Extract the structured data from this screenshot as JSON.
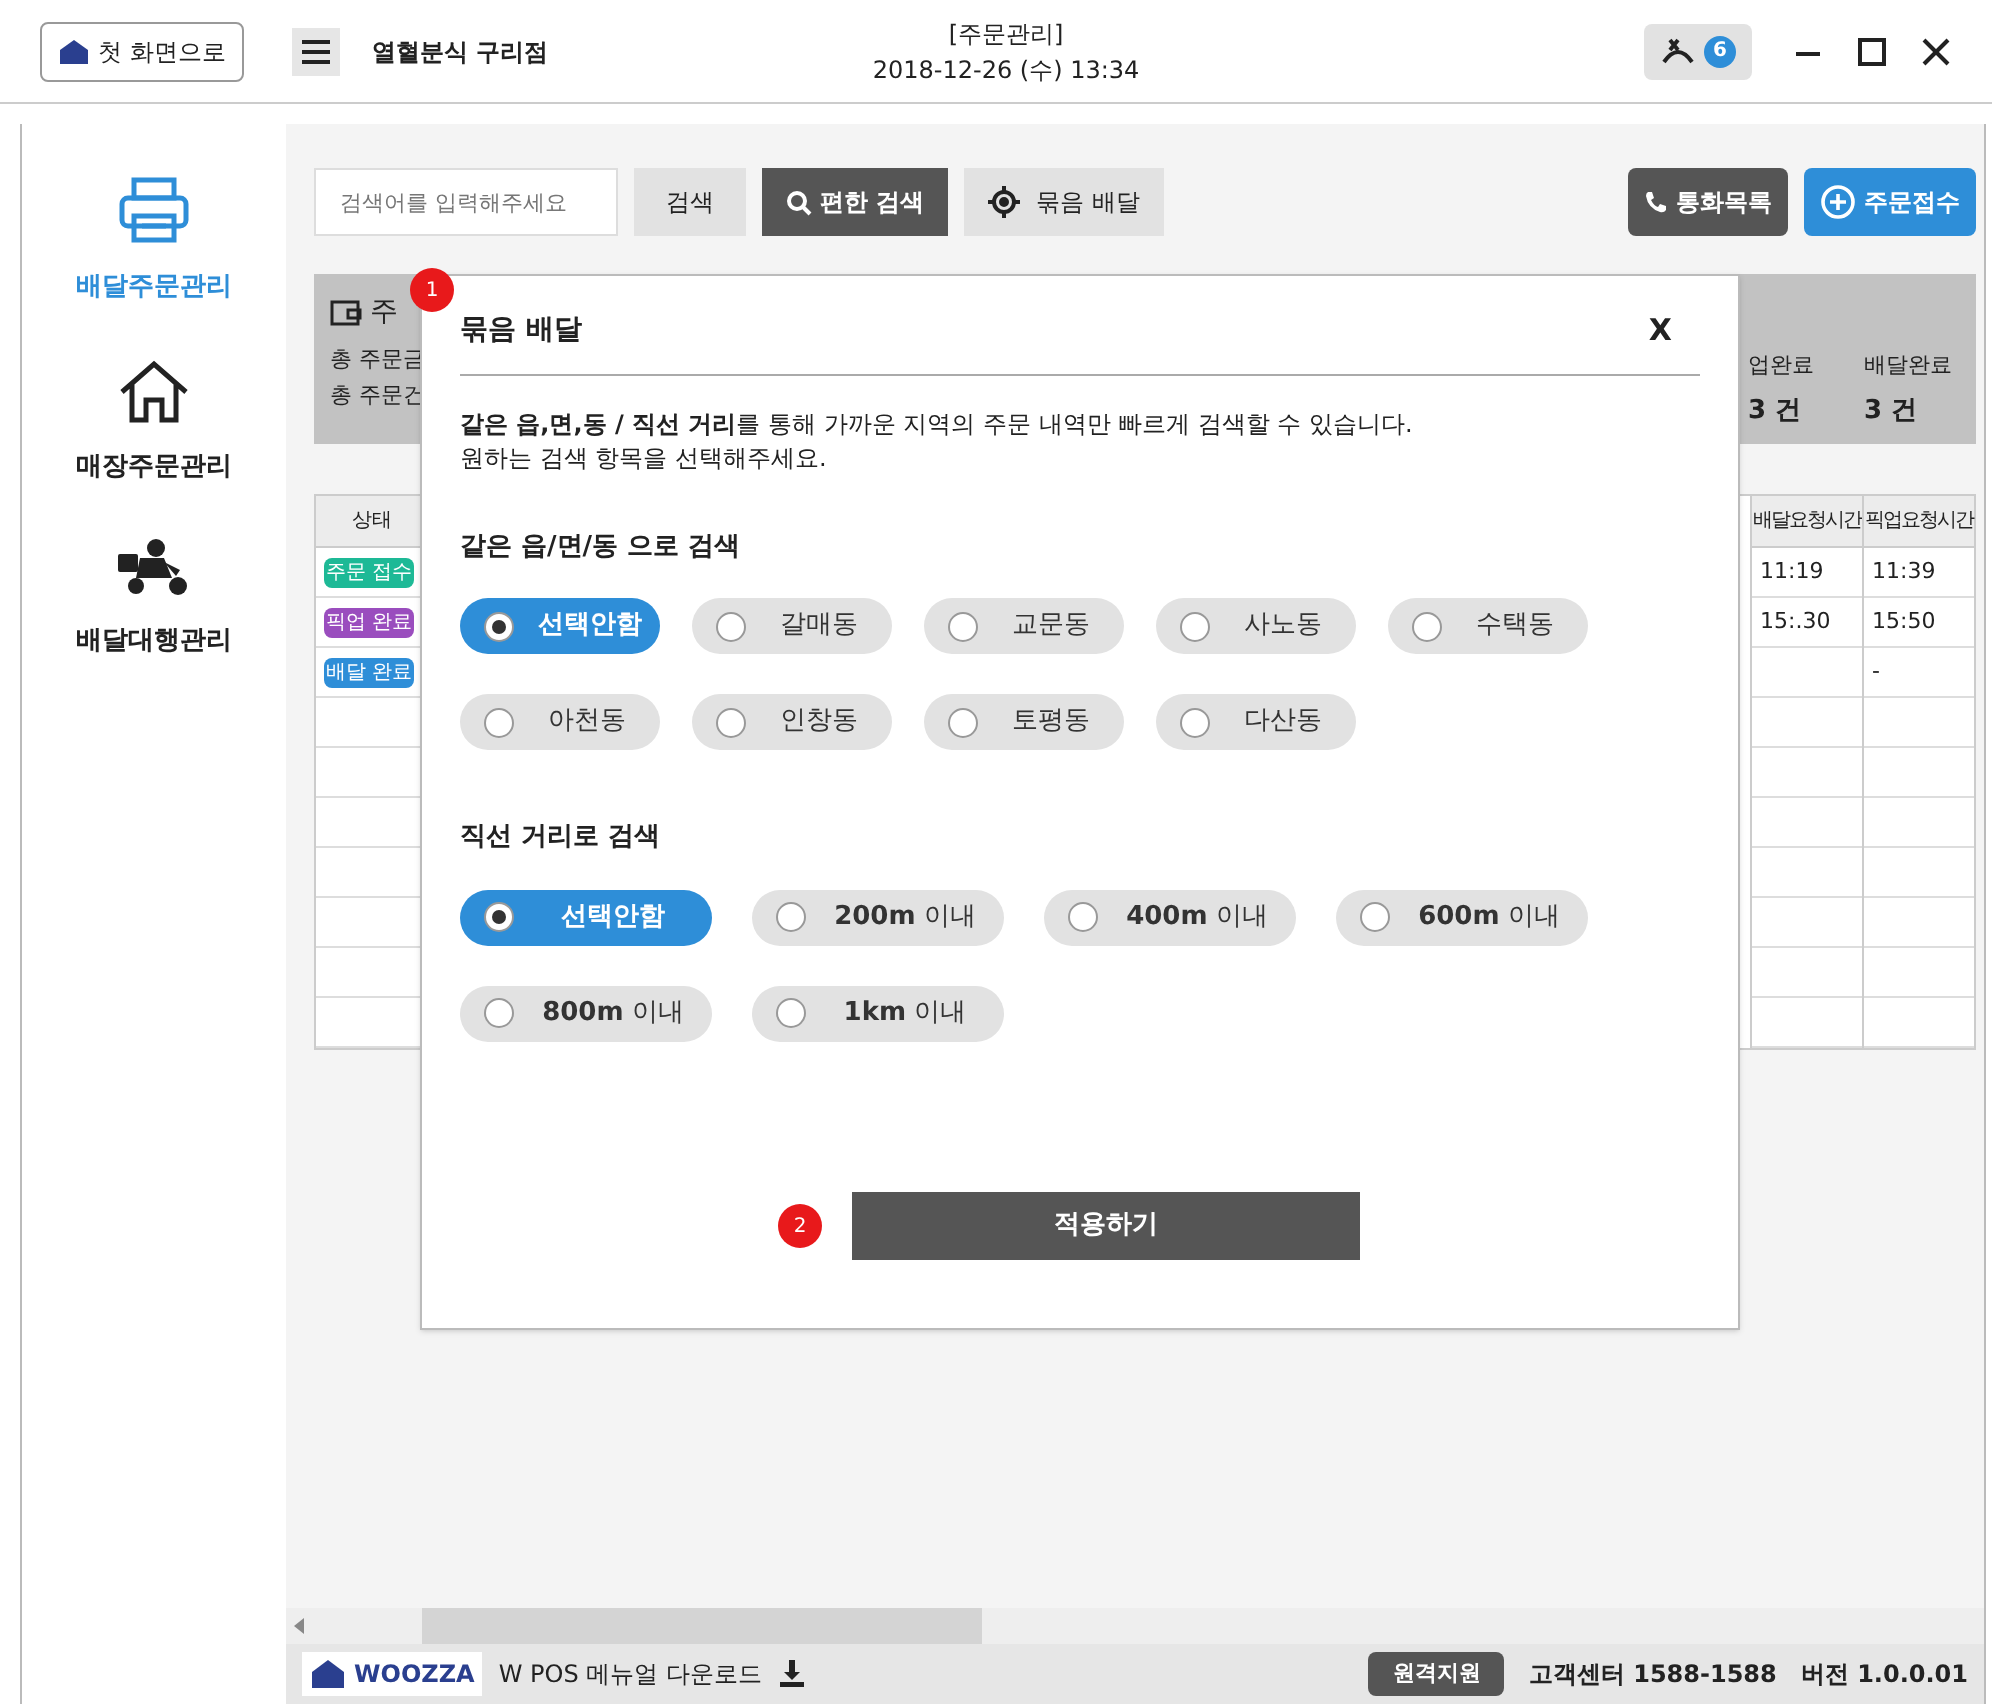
{
  "header": {
    "home_button": "첫 화면으로",
    "store": "열혈분식 구리점",
    "title": "[주문관리]",
    "datetime": "2018-12-26 (수) 13:34",
    "call_count": "6"
  },
  "sidebar": {
    "items": [
      {
        "label": "배달주문관리",
        "selected": true,
        "kind": "printer"
      },
      {
        "label": "매장주문관리",
        "selected": false,
        "kind": "store"
      },
      {
        "label": "배달대행관리",
        "selected": false,
        "kind": "rider"
      }
    ]
  },
  "toolbar": {
    "search": {
      "placeholder": "검색어를 입력해주세요"
    },
    "search_button": "검색",
    "easy_search": "편한 검색",
    "bundle": "묶음 배달",
    "call_log": "통화목록",
    "new_order": "주문접수"
  },
  "summary": {
    "title": "주",
    "lines": [
      "총 주문금",
      "총 주문건"
    ],
    "stats": [
      {
        "label": "업완료",
        "value": "3 건"
      },
      {
        "label": "배달완료",
        "value": "3 건"
      }
    ]
  },
  "table": {
    "columns": [
      "상태",
      "배달요청시간",
      "픽업요청시간"
    ],
    "rows": [
      {
        "status": "주문 접수",
        "color": "#1db996",
        "delivery_time": "11:19",
        "pickup_time": "11:39"
      },
      {
        "status": "픽업 완료",
        "color": "#9a4dbe",
        "delivery_time": "15:.30",
        "pickup_time": "15:50"
      },
      {
        "status": "배달 완료",
        "color": "#2e8ed8",
        "pickup_time": "-"
      }
    ]
  },
  "dialog": {
    "title": "묶음 배달",
    "close": "X",
    "step_badges": [
      "1",
      "2"
    ],
    "description": [
      "**같은 읍,면,동 / 직선 거리**를 통해 가까운 지역의 주문 내역만 빠르게 검색할 수 있습니다.",
      "원하는 검색 항목을 선택해주세요."
    ],
    "sections": [
      {
        "title": "같은 읍/면/동 으로 검색",
        "kind": "area",
        "options": [
          {
            "label": "선택안함",
            "selected": true
          },
          {
            "label": "갈매동",
            "selected": false
          },
          {
            "label": "교문동",
            "selected": false
          },
          {
            "label": "사노동",
            "selected": false
          },
          {
            "label": "수택동",
            "selected": false
          },
          {
            "label": "아천동",
            "selected": false
          },
          {
            "label": "인창동",
            "selected": false
          },
          {
            "label": "토평동",
            "selected": false
          },
          {
            "label": "다산동",
            "selected": false
          }
        ]
      },
      {
        "title": "직선 거리로 검색",
        "kind": "distance",
        "options": [
          {
            "label": "**선택안함**",
            "selected": true
          },
          {
            "label": "**200m** 이내",
            "selected": false
          },
          {
            "label": "**400m** 이내",
            "selected": false
          },
          {
            "label": "**600m** 이내",
            "selected": false
          },
          {
            "label": "**800m** 이내",
            "selected": false
          },
          {
            "label": "**1km** 이내",
            "selected": false
          }
        ]
      }
    ],
    "apply_button": "적용하기"
  },
  "footer": {
    "logo": "WOOZZA",
    "manual": "W POS 메뉴얼 다운로드",
    "remote": "원격지원",
    "support": "고객센터 1588-1588",
    "version": "버전 1.0.0.01"
  }
}
